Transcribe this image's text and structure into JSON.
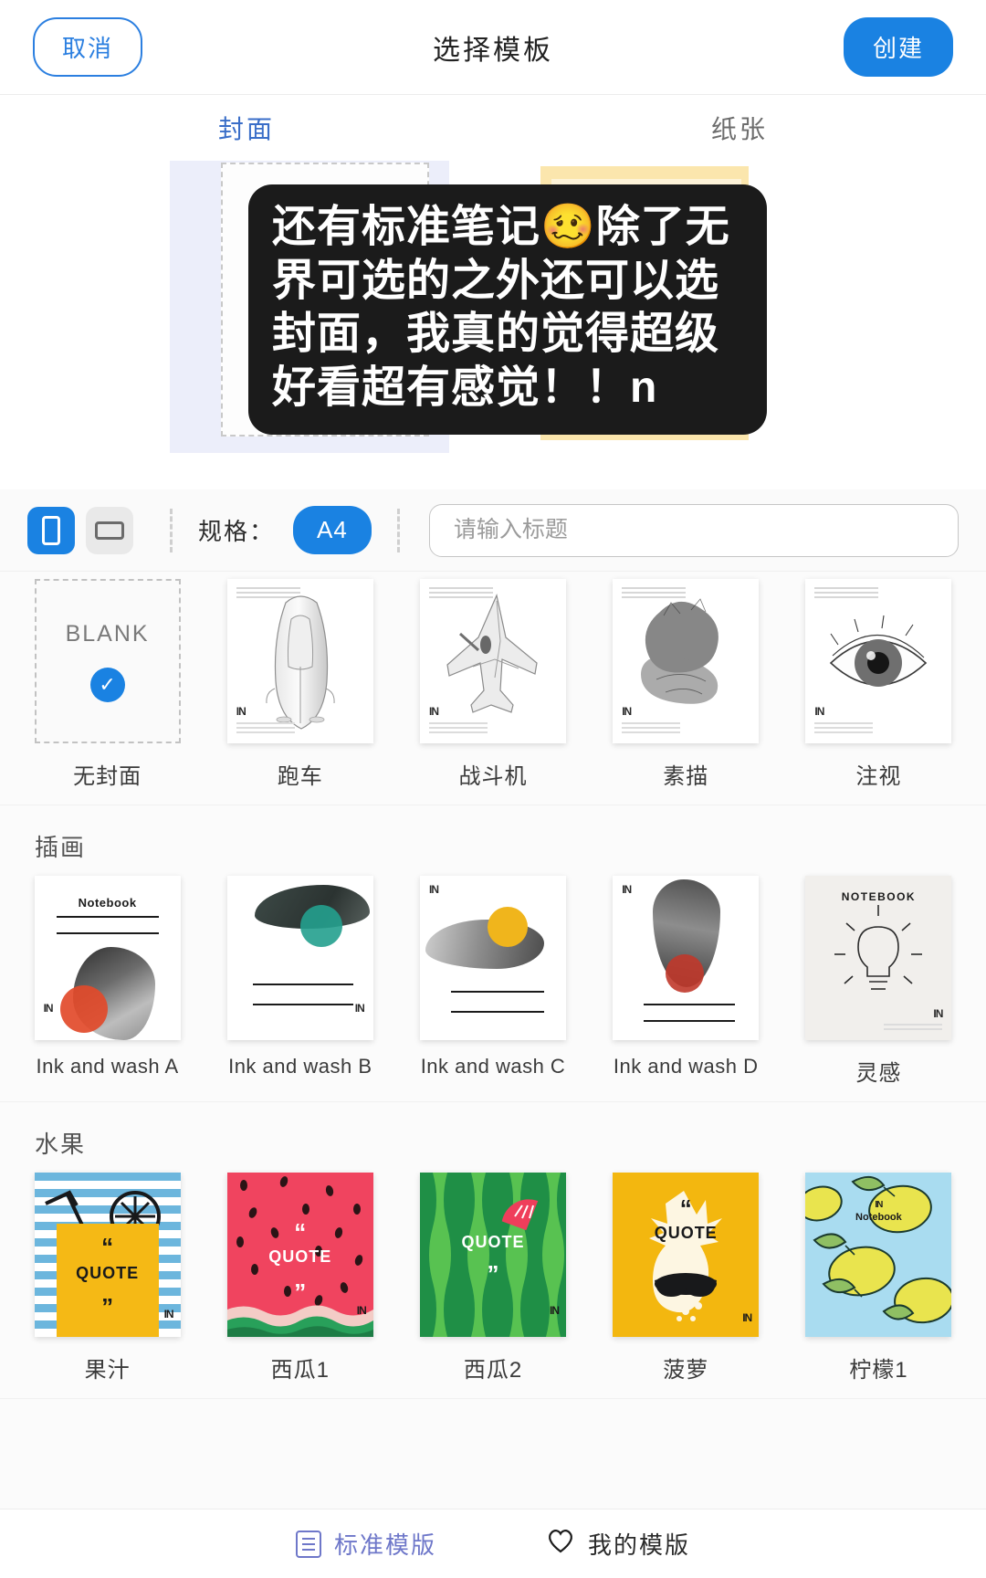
{
  "header": {
    "cancel_label": "取消",
    "title": "选择模板",
    "create_label": "创建"
  },
  "tabs": [
    {
      "label": "封面",
      "active": true
    },
    {
      "label": "纸张",
      "active": false
    }
  ],
  "caption": {
    "text": "还有标准笔记🥴除了无界可选的之外还可以选封面，我真的觉得超级好看超有感觉！！n"
  },
  "toolbar": {
    "orientation_portrait_icon": "portrait-icon",
    "orientation_landscape_icon": "landscape-icon",
    "spec_label": "规格：",
    "spec_value": "A4",
    "title_placeholder": "请输入标题",
    "title_value": ""
  },
  "preview": {
    "blank_text": "BLANK"
  },
  "sections": [
    {
      "title": "",
      "items": [
        {
          "label": "无封面",
          "kind": "blank",
          "blank_text": "BLANK",
          "selected": true
        },
        {
          "label": "跑车",
          "kind": "sketch-car"
        },
        {
          "label": "战斗机",
          "kind": "sketch-jet"
        },
        {
          "label": "素描",
          "kind": "sketch-cats"
        },
        {
          "label": "注视",
          "kind": "sketch-eye"
        }
      ]
    },
    {
      "title": "插画",
      "items": [
        {
          "label": "Ink and wash A",
          "kind": "ink-a",
          "cover_text": "Notebook"
        },
        {
          "label": "Ink and wash B",
          "kind": "ink-b"
        },
        {
          "label": "Ink and wash C",
          "kind": "ink-c"
        },
        {
          "label": "Ink and wash D",
          "kind": "ink-d"
        },
        {
          "label": "灵感",
          "kind": "bulb",
          "cover_text": "NOTEBOOK"
        }
      ]
    },
    {
      "title": "水果",
      "items": [
        {
          "label": "果汁",
          "kind": "juice",
          "quote": "QUOTE"
        },
        {
          "label": "西瓜1",
          "kind": "watermelon1",
          "quote": "QUOTE"
        },
        {
          "label": "西瓜2",
          "kind": "watermelon2",
          "quote": "QUOTE"
        },
        {
          "label": "菠萝",
          "kind": "pineapple",
          "quote": "QUOTE"
        },
        {
          "label": "柠檬1",
          "kind": "lemon",
          "cover_text": "Notebook"
        }
      ]
    }
  ],
  "bottombar": {
    "items": [
      {
        "label": "标准模版",
        "icon": "list-icon",
        "active": true
      },
      {
        "label": "我的模版",
        "icon": "heart-icon",
        "active": false
      }
    ]
  },
  "colors": {
    "accent_blue": "#1a82e2",
    "tab_blue": "#3b6fd4",
    "caption_bg": "#1b1b1b",
    "bottom_active": "#6e77c9"
  }
}
